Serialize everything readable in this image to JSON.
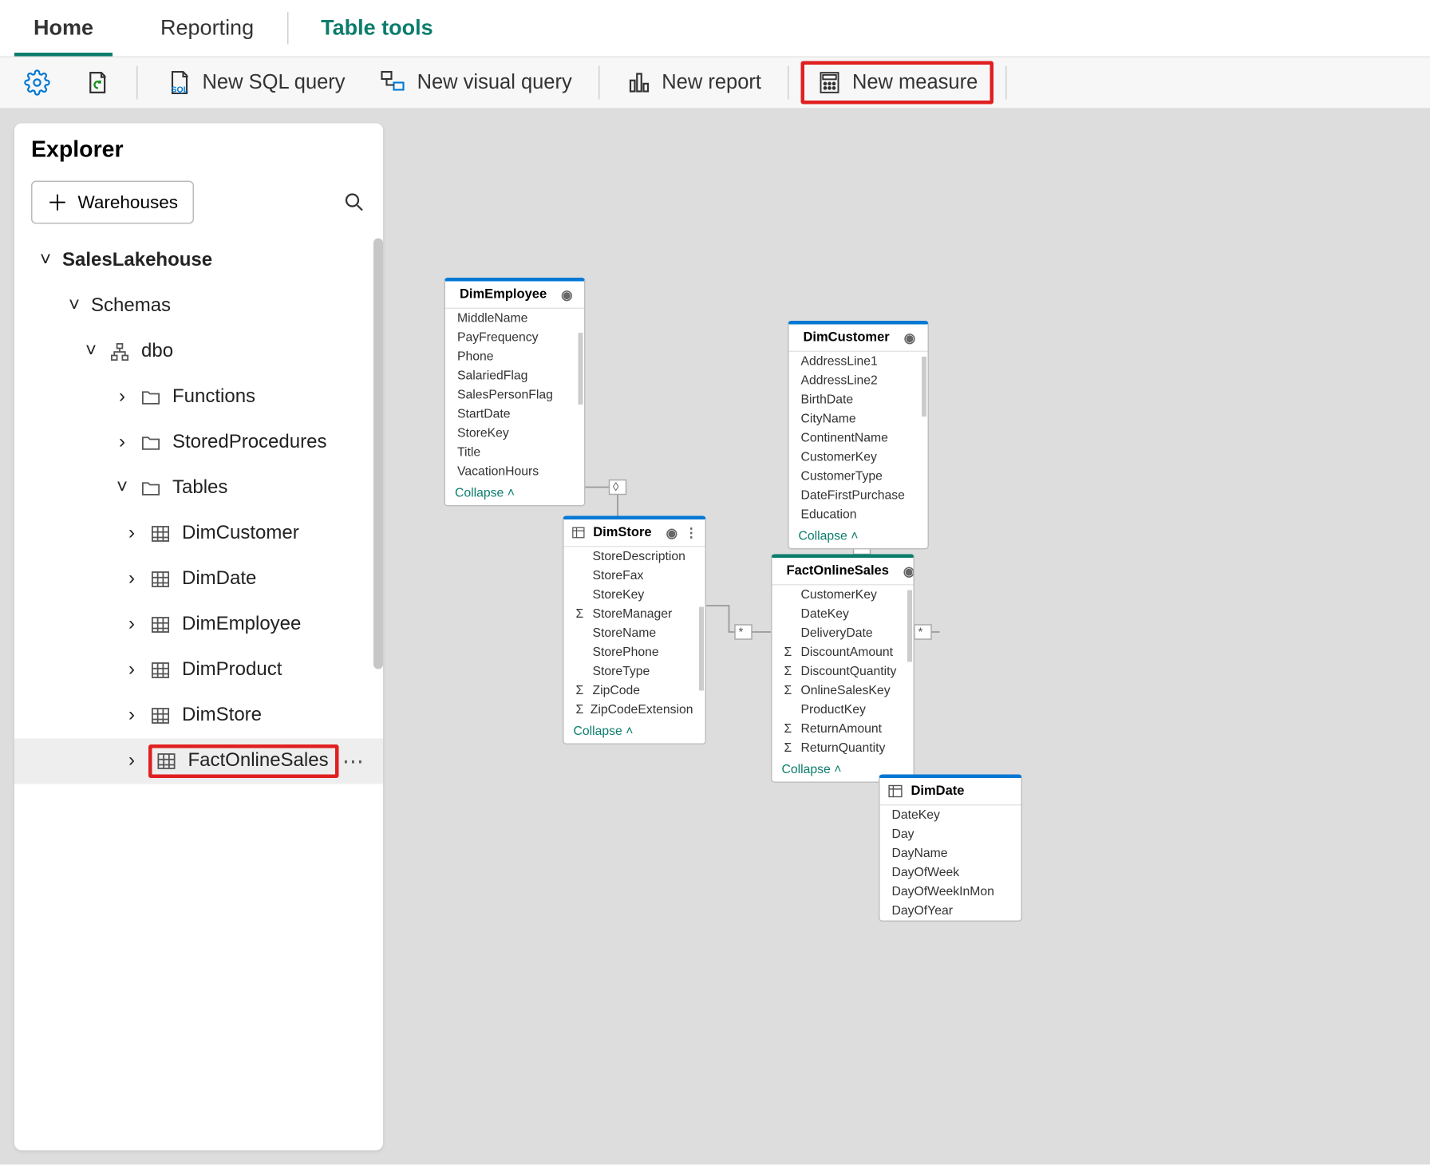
{
  "tabs": {
    "home": "Home",
    "reporting": "Reporting",
    "table_tools": "Table tools"
  },
  "ribbon": {
    "new_sql_query": "New SQL query",
    "new_visual_query": "New visual query",
    "new_report": "New report",
    "new_measure": "New measure"
  },
  "explorer": {
    "title": "Explorer",
    "add_label": "Warehouses",
    "tree": {
      "root": "SalesLakehouse",
      "schemas": "Schemas",
      "dbo": "dbo",
      "functions": "Functions",
      "stored_procedures": "StoredProcedures",
      "tables": "Tables",
      "table_items": [
        "DimCustomer",
        "DimDate",
        "DimEmployee",
        "DimProduct",
        "DimStore",
        "FactOnlineSales"
      ]
    }
  },
  "diagram": {
    "collapse": "Collapse",
    "dim_employee": {
      "name": "DimEmployee",
      "fields": [
        "MiddleName",
        "PayFrequency",
        "Phone",
        "SalariedFlag",
        "SalesPersonFlag",
        "StartDate",
        "StoreKey",
        "Title",
        "VacationHours"
      ]
    },
    "dim_customer": {
      "name": "DimCustomer",
      "fields": [
        "AddressLine1",
        "AddressLine2",
        "BirthDate",
        "CityName",
        "ContinentName",
        "CustomerKey",
        "CustomerType",
        "DateFirstPurchase",
        "Education"
      ]
    },
    "dim_store": {
      "name": "DimStore",
      "fields": [
        {
          "t": "StoreDescription"
        },
        {
          "t": "StoreFax"
        },
        {
          "t": "StoreKey"
        },
        {
          "t": "StoreManager",
          "sigma": true
        },
        {
          "t": "StoreName"
        },
        {
          "t": "StorePhone"
        },
        {
          "t": "StoreType"
        },
        {
          "t": "ZipCode",
          "sigma": true
        },
        {
          "t": "ZipCodeExtension",
          "sigma": true
        }
      ]
    },
    "fact_online_sales": {
      "name": "FactOnlineSales",
      "fields": [
        {
          "t": "CustomerKey"
        },
        {
          "t": "DateKey"
        },
        {
          "t": "DeliveryDate"
        },
        {
          "t": "DiscountAmount",
          "sigma": true
        },
        {
          "t": "DiscountQuantity",
          "sigma": true
        },
        {
          "t": "OnlineSalesKey",
          "sigma": true
        },
        {
          "t": "ProductKey"
        },
        {
          "t": "ReturnAmount",
          "sigma": true
        },
        {
          "t": "ReturnQuantity",
          "sigma": true
        }
      ]
    },
    "dim_date": {
      "name": "DimDate",
      "fields": [
        "DateKey",
        "Day",
        "DayName",
        "DayOfWeek",
        "DayOfWeekInMon",
        "DayOfYear"
      ]
    }
  }
}
